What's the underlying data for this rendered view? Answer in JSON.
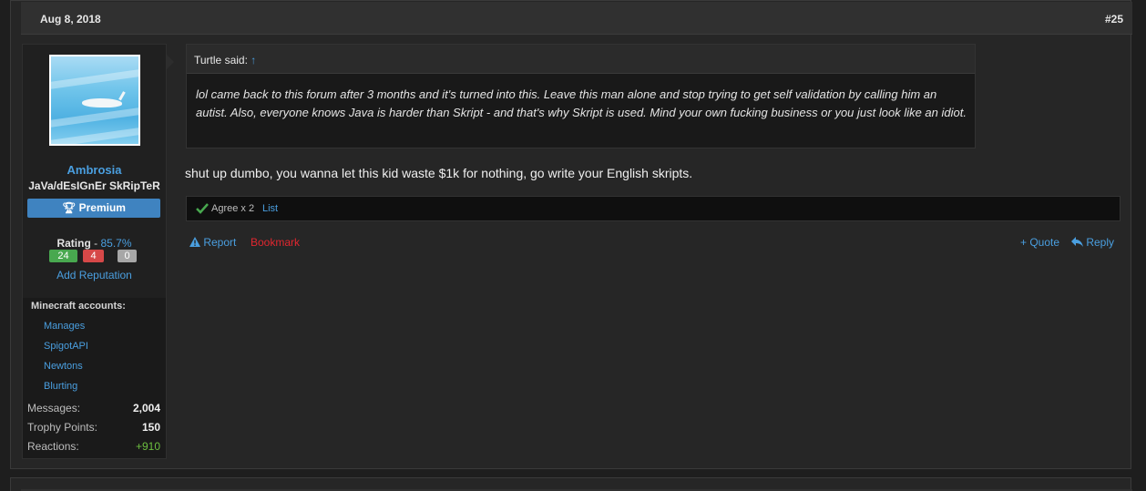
{
  "post": {
    "date": "Aug 8, 2018",
    "number": "#25"
  },
  "user": {
    "name": "Ambrosia",
    "title": "JaVa/dEsIGnEr SkRipTeR",
    "badge": "Premium",
    "rating_label": "Rating",
    "rating_separator": " - ",
    "rating_pct": "85.7%",
    "ratings": {
      "positive": "24",
      "negative": "4",
      "neutral": "0"
    },
    "add_reputation": "Add Reputation",
    "minecraft_title": "Minecraft accounts:",
    "minecraft_accounts": [
      "Manages",
      "SpigotAPI",
      "Newtons",
      "Blurting"
    ],
    "stats": [
      {
        "label": "Messages:",
        "value": "2,004"
      },
      {
        "label": "Trophy Points:",
        "value": "150"
      },
      {
        "label": "Reactions:",
        "value": "+910"
      }
    ]
  },
  "quote": {
    "author": "Turtle said:",
    "arrow": "↑",
    "text": "lol came back to this forum after 3 months and it's turned into this. Leave this man alone and stop trying to get self validation by calling him an autist. Also, everyone knows Java is harder than Skript - and that's why Skript is used. Mind your own fucking business or you just look like an idiot."
  },
  "message": "shut up dumbo, you wanna let this kid waste $1k for nothing, go write your English skripts.",
  "reactions": {
    "summary": "Agree x 2",
    "list_label": "List"
  },
  "actions": {
    "report": "Report",
    "bookmark": "Bookmark",
    "quote": "+ Quote",
    "reply": "Reply"
  },
  "colors": {
    "accent": "#4a9fe0",
    "bookmark": "#e0262f",
    "premium": "#3f83c0",
    "positive": "#48a84f",
    "negative": "#d64848",
    "neutral": "#a7a7a7",
    "reactions_plus": "#6cbf3f"
  },
  "icons": {
    "report": "warning-triangle-icon",
    "premium": "trophy-icon",
    "agree": "checkmark-icon",
    "reply": "reply-arrow-icon"
  }
}
